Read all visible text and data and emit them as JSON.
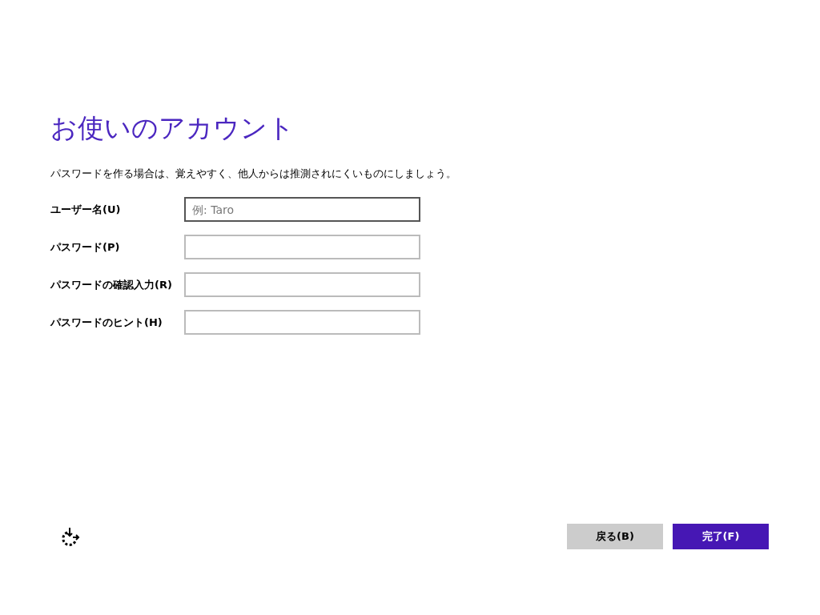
{
  "title": "お使いのアカウント",
  "description": "パスワードを作る場合は、覚えやすく、他人からは推測されにくいものにしましょう。",
  "fields": [
    {
      "label": "ユーザー名(U)",
      "placeholder": "例: Taro",
      "focused": true
    },
    {
      "label": "パスワード(P)",
      "focused": false
    },
    {
      "label": "パスワードの確認入力(R)",
      "focused": false
    },
    {
      "label": "パスワードのヒント(H)",
      "focused": false
    }
  ],
  "buttons": [
    {
      "label": "戻る(B)",
      "kind": "secondary"
    },
    {
      "label": "完了(F)",
      "kind": "primary"
    }
  ]
}
